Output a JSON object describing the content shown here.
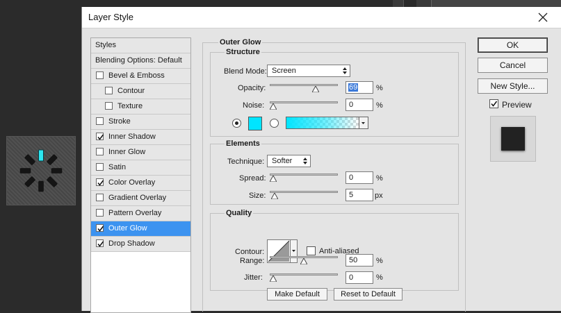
{
  "dialog": {
    "title": "Layer Style",
    "close_glyph": "✕"
  },
  "styles_list": {
    "header": "Styles",
    "items": [
      {
        "label": "Blending Options: Default",
        "checkbox": false,
        "checked": false,
        "indent": false,
        "selected": false
      },
      {
        "label": "Bevel & Emboss",
        "checkbox": true,
        "checked": false,
        "indent": false,
        "selected": false
      },
      {
        "label": "Contour",
        "checkbox": true,
        "checked": false,
        "indent": true,
        "selected": false
      },
      {
        "label": "Texture",
        "checkbox": true,
        "checked": false,
        "indent": true,
        "selected": false
      },
      {
        "label": "Stroke",
        "checkbox": true,
        "checked": false,
        "indent": false,
        "selected": false
      },
      {
        "label": "Inner Shadow",
        "checkbox": true,
        "checked": true,
        "indent": false,
        "selected": false
      },
      {
        "label": "Inner Glow",
        "checkbox": true,
        "checked": false,
        "indent": false,
        "selected": false
      },
      {
        "label": "Satin",
        "checkbox": true,
        "checked": false,
        "indent": false,
        "selected": false
      },
      {
        "label": "Color Overlay",
        "checkbox": true,
        "checked": true,
        "indent": false,
        "selected": false
      },
      {
        "label": "Gradient Overlay",
        "checkbox": true,
        "checked": false,
        "indent": false,
        "selected": false
      },
      {
        "label": "Pattern Overlay",
        "checkbox": true,
        "checked": false,
        "indent": false,
        "selected": false
      },
      {
        "label": "Outer Glow",
        "checkbox": true,
        "checked": true,
        "indent": false,
        "selected": true
      },
      {
        "label": "Drop Shadow",
        "checkbox": true,
        "checked": true,
        "indent": false,
        "selected": false
      }
    ]
  },
  "outer_glow": {
    "title": "Outer Glow",
    "structure": {
      "title": "Structure",
      "blend_mode_label": "Blend Mode:",
      "blend_mode_value": "Screen",
      "opacity_label": "Opacity:",
      "opacity_value": "69",
      "opacity_unit": "%",
      "opacity_level": 0.69,
      "noise_label": "Noise:",
      "noise_value": "0",
      "noise_unit": "%",
      "noise_level": 0,
      "glow_color": "#00e5ff"
    },
    "elements": {
      "title": "Elements",
      "technique_label": "Technique:",
      "technique_value": "Softer",
      "spread_label": "Spread:",
      "spread_value": "0",
      "spread_unit": "%",
      "spread_level": 0,
      "size_label": "Size:",
      "size_value": "5",
      "size_unit": "px",
      "size_level": 0.02
    },
    "quality": {
      "title": "Quality",
      "contour_label": "Contour:",
      "anti_aliased_label": "Anti-aliased",
      "anti_aliased_checked": false,
      "range_label": "Range:",
      "range_value": "50",
      "range_unit": "%",
      "range_level": 0.5,
      "jitter_label": "Jitter:",
      "jitter_value": "0",
      "jitter_unit": "%",
      "jitter_level": 0
    },
    "make_default_label": "Make Default",
    "reset_default_label": "Reset to Default"
  },
  "buttons": {
    "ok": "OK",
    "cancel": "Cancel",
    "new_style": "New Style...",
    "preview_label": "Preview",
    "preview_checked": true
  },
  "colors": {
    "selection": "#3c93f0",
    "glow": "#00e5ff"
  },
  "icons": {
    "close": "close-icon",
    "dropdown": "updown-arrow-icon",
    "checkmark": "checkmark-icon",
    "slider_thumb": "triangle-thumb-icon"
  }
}
